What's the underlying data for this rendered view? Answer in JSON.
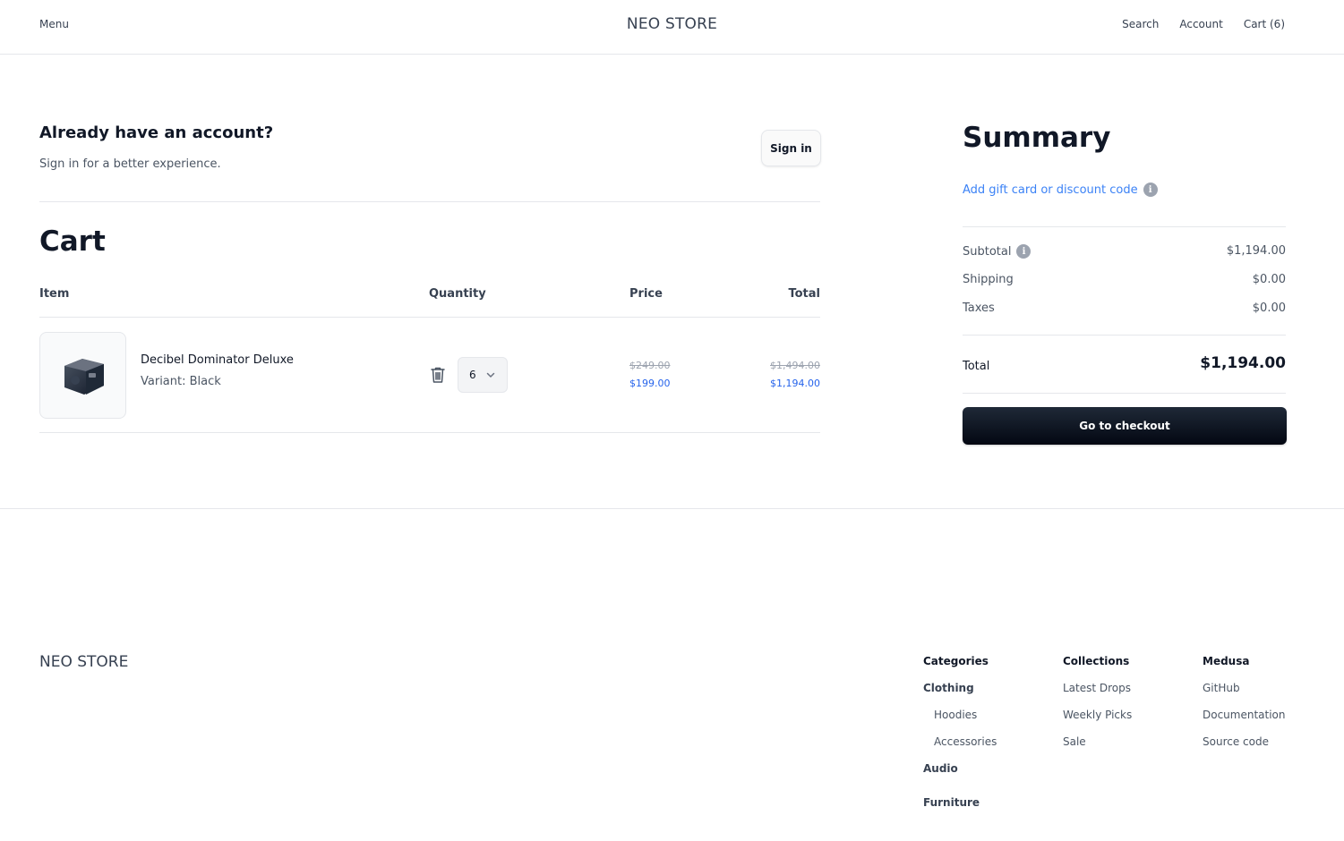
{
  "header": {
    "menu_label": "Menu",
    "brand": "NEO STORE",
    "nav": {
      "search": "Search",
      "account": "Account",
      "cart": "Cart (6)"
    }
  },
  "account_prompt": {
    "title": "Already have an account?",
    "subtitle": "Sign in for a better experience.",
    "signin_label": "Sign in"
  },
  "cart": {
    "title": "Cart",
    "columns": {
      "item": "Item",
      "quantity": "Quantity",
      "price": "Price",
      "total": "Total"
    },
    "items": [
      {
        "name": "Decibel Dominator Deluxe",
        "variant": "Variant: Black",
        "quantity": "6",
        "price_original": "$249.00",
        "price_sale": "$199.00",
        "total_original": "$1,494.00",
        "total_sale": "$1,194.00",
        "thumbnail_icon": "speaker-product-image",
        "remove_icon": "trash-icon"
      }
    ]
  },
  "summary": {
    "title": "Summary",
    "gift_link": "Add gift card or discount code",
    "subtotal_label": "Subtotal",
    "subtotal": "$1,194.00",
    "shipping_label": "Shipping",
    "shipping": "$0.00",
    "taxes_label": "Taxes",
    "taxes": "$0.00",
    "total_label": "Total",
    "total": "$1,194.00",
    "checkout_label": "Go to checkout"
  },
  "footer": {
    "brand": "NEO STORE",
    "categories": {
      "heading": "Categories",
      "clothing": "Clothing",
      "hoodies": "Hoodies",
      "accessories": "Accessories",
      "audio": "Audio",
      "furniture": "Furniture"
    },
    "collections": {
      "heading": "Collections",
      "links": [
        "Latest Drops",
        "Weekly Picks",
        "Sale"
      ]
    },
    "medusa": {
      "heading": "Medusa",
      "links": [
        "GitHub",
        "Documentation",
        "Source code"
      ]
    }
  },
  "colors": {
    "accent_link": "#3b82f6",
    "sale_price": "#2563eb",
    "checkout_bg": "#0b0f19",
    "border": "#e5e7eb"
  }
}
